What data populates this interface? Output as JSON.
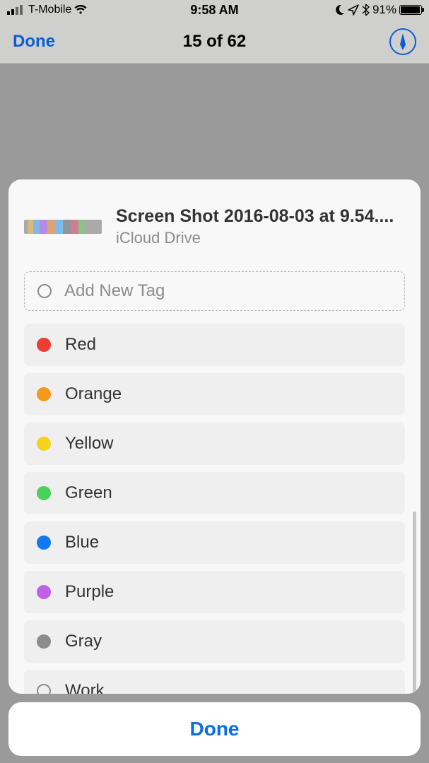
{
  "status": {
    "carrier": "T-Mobile",
    "time": "9:58 AM",
    "battery_pct": "91%",
    "battery_level": 0.91
  },
  "nav": {
    "done_label": "Done",
    "title": "15 of 62"
  },
  "file": {
    "name": "Screen Shot 2016-08-03 at 9.54....",
    "location": "iCloud Drive"
  },
  "add_tag": {
    "placeholder": "Add New Tag"
  },
  "tags": [
    {
      "label": "Red",
      "color": "#ec3c33"
    },
    {
      "label": "Orange",
      "color": "#f39a1d"
    },
    {
      "label": "Yellow",
      "color": "#f6d11e"
    },
    {
      "label": "Green",
      "color": "#48d25a"
    },
    {
      "label": "Blue",
      "color": "#1078f1"
    },
    {
      "label": "Purple",
      "color": "#c060e6"
    },
    {
      "label": "Gray",
      "color": "#8c8c8c"
    },
    {
      "label": "Work",
      "color": null
    }
  ],
  "bottom": {
    "done_label": "Done"
  }
}
